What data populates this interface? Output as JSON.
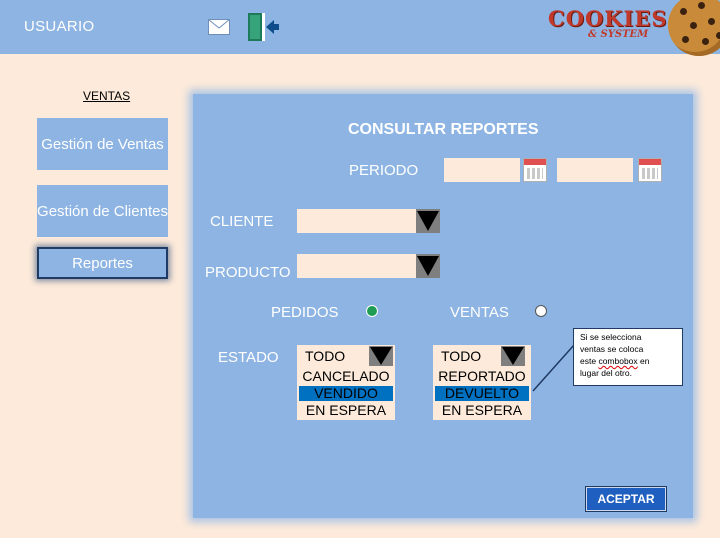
{
  "header": {
    "user_label": "USUARIO",
    "mail_icon": "mail-icon",
    "logout_icon": "exit-door-icon",
    "logo": {
      "word": "COOKIES",
      "sub": "& SYSTEM"
    }
  },
  "sidebar": {
    "heading": "VENTAS",
    "items": [
      {
        "label": "Gestión de Ventas",
        "active": false
      },
      {
        "label": "Gestión de Clientes",
        "active": false
      },
      {
        "label": "Reportes",
        "active": true
      }
    ]
  },
  "main": {
    "title": "CONSULTAR REPORTES",
    "periodo_label": "PERIODO",
    "date_from_value": "",
    "date_to_value": "",
    "calendar_icon": "calendar-icon",
    "cliente_label": "CLIENTE",
    "cliente_value": "",
    "producto_label": "PRODUCTO",
    "producto_value": "",
    "pedidos_label": "PEDIDOS",
    "pedidos_selected": true,
    "ventas_label": "VENTAS",
    "ventas_selected": false,
    "estado_label": "ESTADO",
    "estado_pedidos": {
      "selected": "TODO",
      "options": [
        "TODO",
        "CANCELADO",
        "VENDIDO",
        "EN ESPERA"
      ],
      "highlighted": "VENDIDO"
    },
    "estado_ventas": {
      "selected": "TODO",
      "options": [
        "TODO",
        "REPORTADO",
        "DEVUELTO",
        "EN ESPERA"
      ],
      "highlighted": "DEVUELTO"
    },
    "note": {
      "line1": "Si se selecciona",
      "line2": "ventas se coloca",
      "line3_pre": "este ",
      "line3_word": "combobox",
      "line3_post": " en",
      "line4": "lugar  del otro."
    },
    "accept_label": "ACEPTAR"
  },
  "colors": {
    "background": "#fdeada",
    "accent": "#8db4e2",
    "selection": "#0070c0",
    "button": "#1f5fbf",
    "radio_on": "#1f9d55"
  }
}
